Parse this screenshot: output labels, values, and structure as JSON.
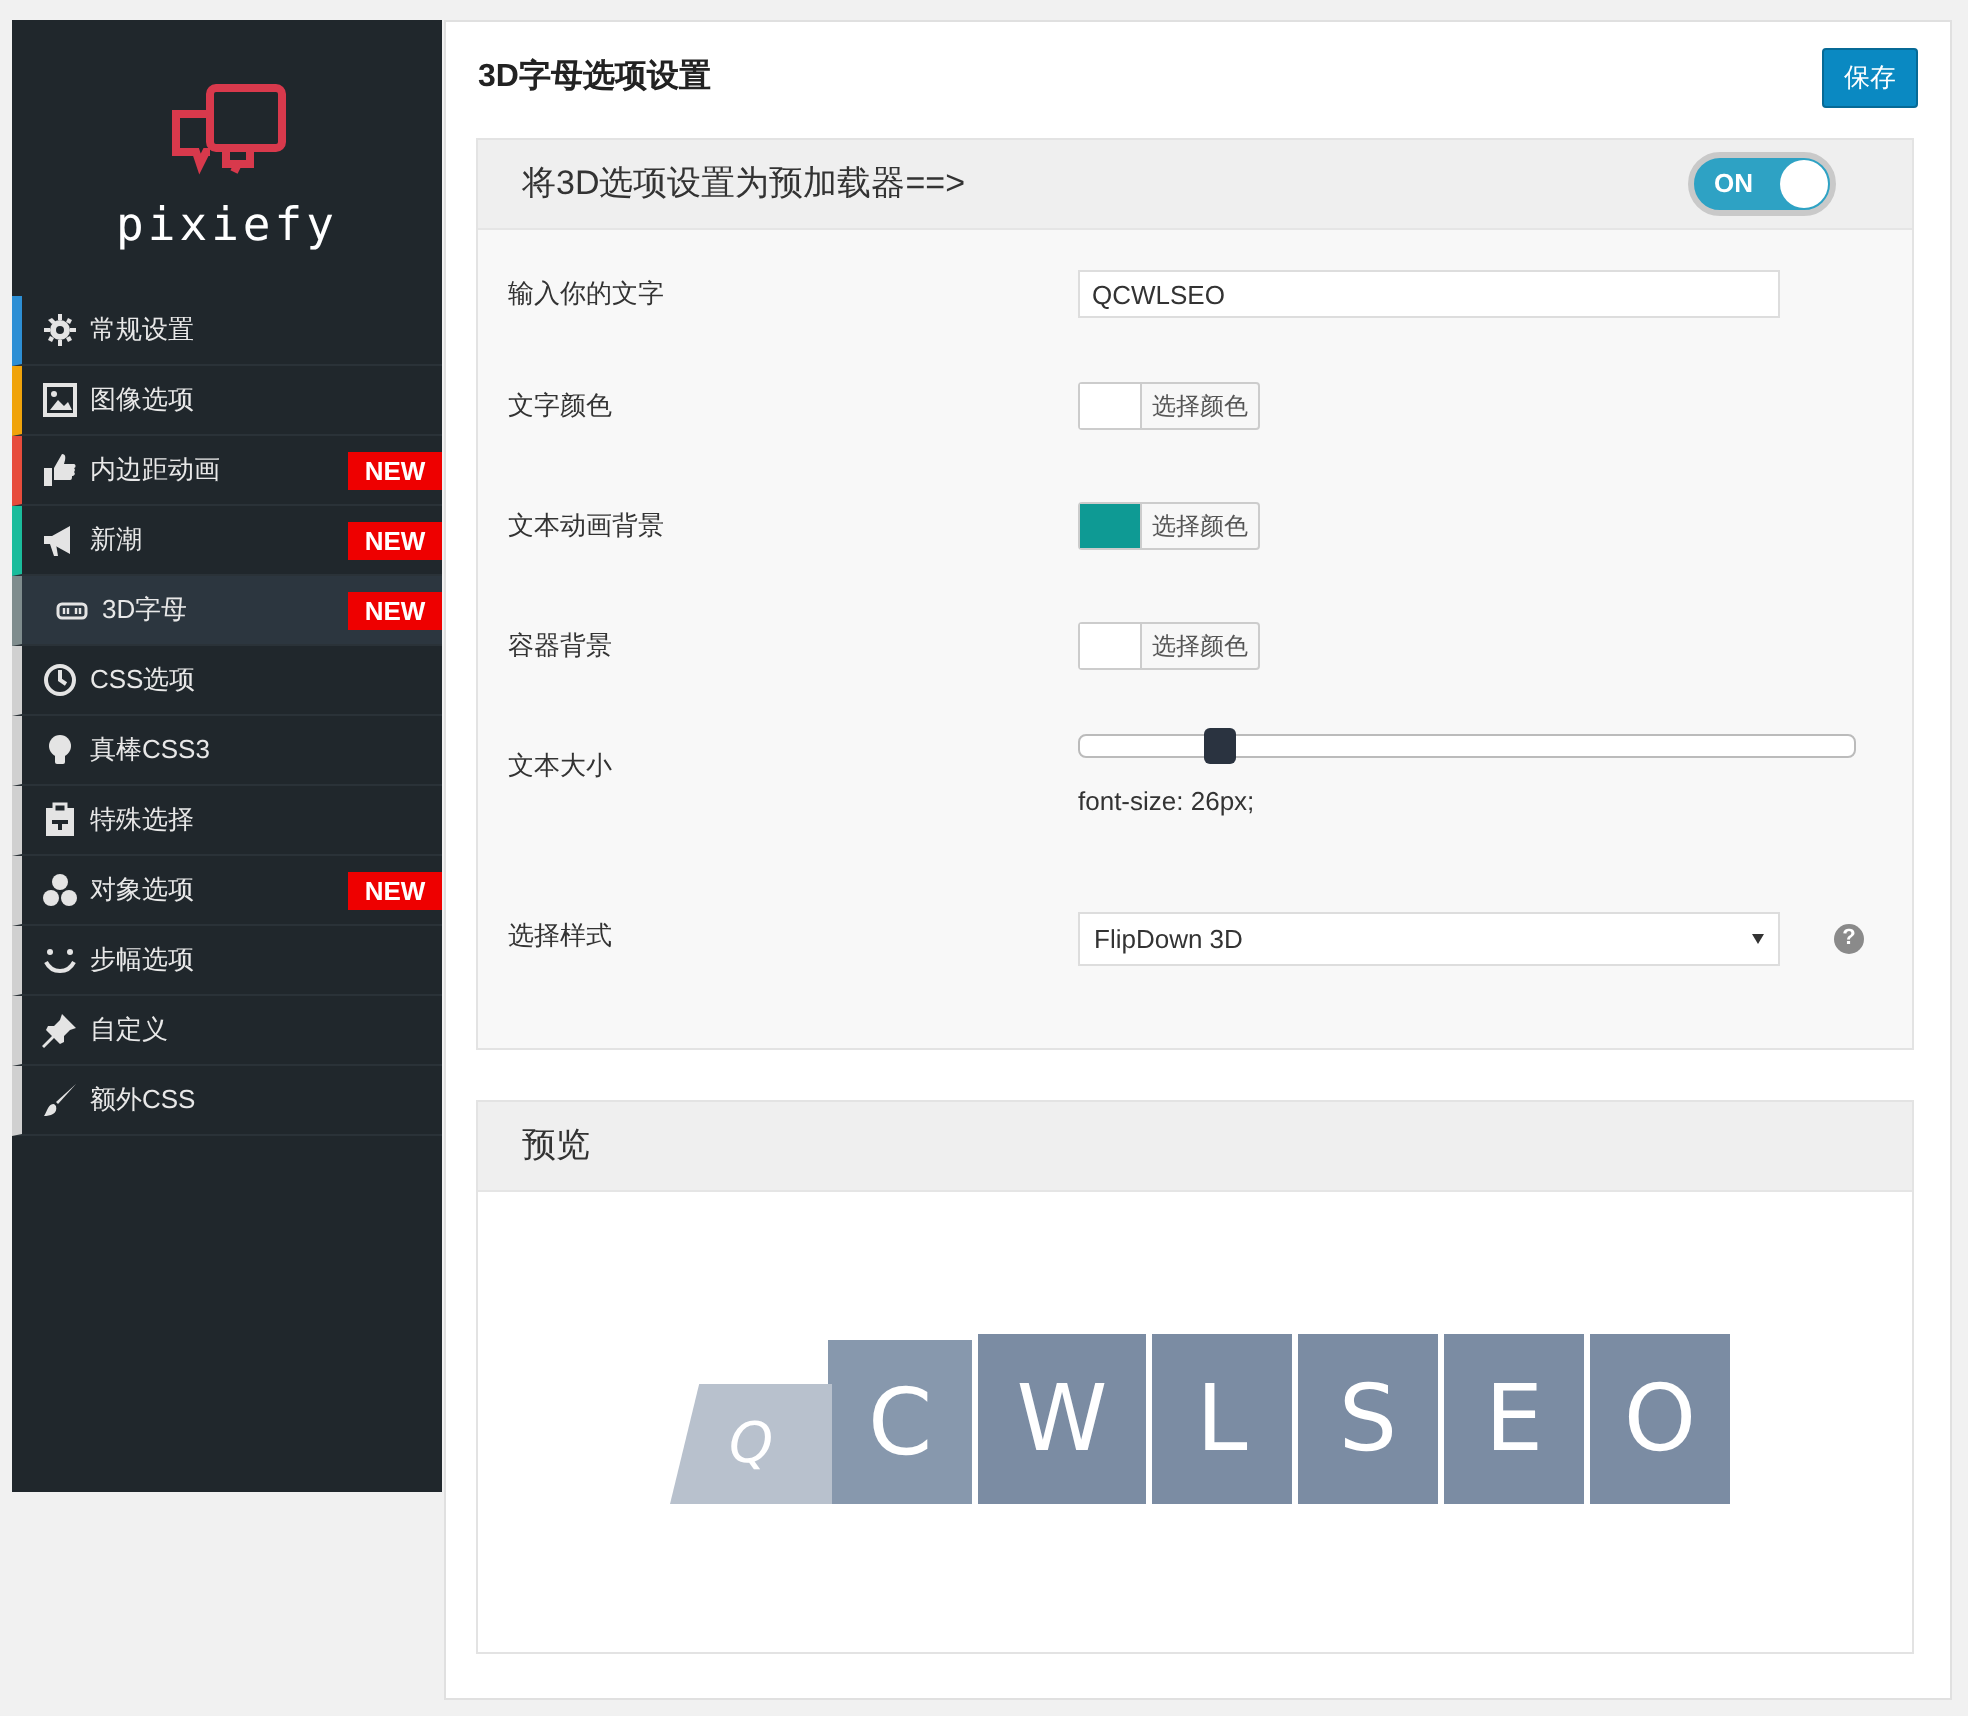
{
  "sidebar": {
    "logo_text": "pixiefy",
    "items": [
      {
        "label": "常规设置",
        "color": "#2d8fd5",
        "selected": false
      },
      {
        "label": "图像选项",
        "color": "#f0a30a",
        "selected": false
      },
      {
        "label": "内边距动画",
        "color": "#e74c3c",
        "selected": false,
        "badge": "NEW"
      },
      {
        "label": "新潮",
        "color": "#1abc9c",
        "selected": false,
        "badge": "NEW"
      },
      {
        "label": "3D字母",
        "color": "#7f8c8d",
        "selected": true,
        "badge": "NEW"
      },
      {
        "label": "CSS选项",
        "color": "#d0d0d0",
        "selected": false
      },
      {
        "label": "真棒CSS3",
        "color": "#d0d0d0",
        "selected": false
      },
      {
        "label": "特殊选择",
        "color": "#d0d0d0",
        "selected": false
      },
      {
        "label": "对象选项",
        "color": "#d0d0d0",
        "selected": false,
        "badge": "NEW"
      },
      {
        "label": "步幅选项",
        "color": "#d0d0d0",
        "selected": false
      },
      {
        "label": "自定义",
        "color": "#d0d0d0",
        "selected": false
      },
      {
        "label": "额外CSS",
        "color": "#d0d0d0",
        "selected": false
      }
    ]
  },
  "page": {
    "title": "3D字母选项设置",
    "save_button": "保存"
  },
  "settings": {
    "header": "将3D选项设置为预加载器==>",
    "toggle": {
      "label": "ON",
      "on": true
    },
    "rows": [
      {
        "kind": "text",
        "label": "输入你的文字",
        "value": "QCWLSEO"
      },
      {
        "kind": "color",
        "label": "文字颜色",
        "color": "#ffffff",
        "button": "选择颜色"
      },
      {
        "kind": "color",
        "label": "文本动画背景",
        "color": "#0e9a94",
        "button": "选择颜色"
      },
      {
        "kind": "color",
        "label": "容器背景",
        "color": "#ffffff",
        "button": "选择颜色"
      },
      {
        "kind": "slider",
        "label": "文本大小",
        "level": 0.18,
        "reading": "font-size: 26px;"
      },
      {
        "kind": "select",
        "label": "选择样式",
        "value": "FlipDown 3D",
        "help": "?"
      }
    ]
  },
  "preview": {
    "header": "预览",
    "letters": [
      {
        "letter": "Q",
        "kind": "flipping"
      },
      {
        "letter": "C",
        "kind": "rising"
      },
      {
        "letter": "W",
        "kind": "settled"
      },
      {
        "letter": "L",
        "kind": "settled"
      },
      {
        "letter": "S",
        "kind": "settled"
      },
      {
        "letter": "E",
        "kind": "settled"
      },
      {
        "letter": "O",
        "kind": "settled"
      }
    ]
  }
}
